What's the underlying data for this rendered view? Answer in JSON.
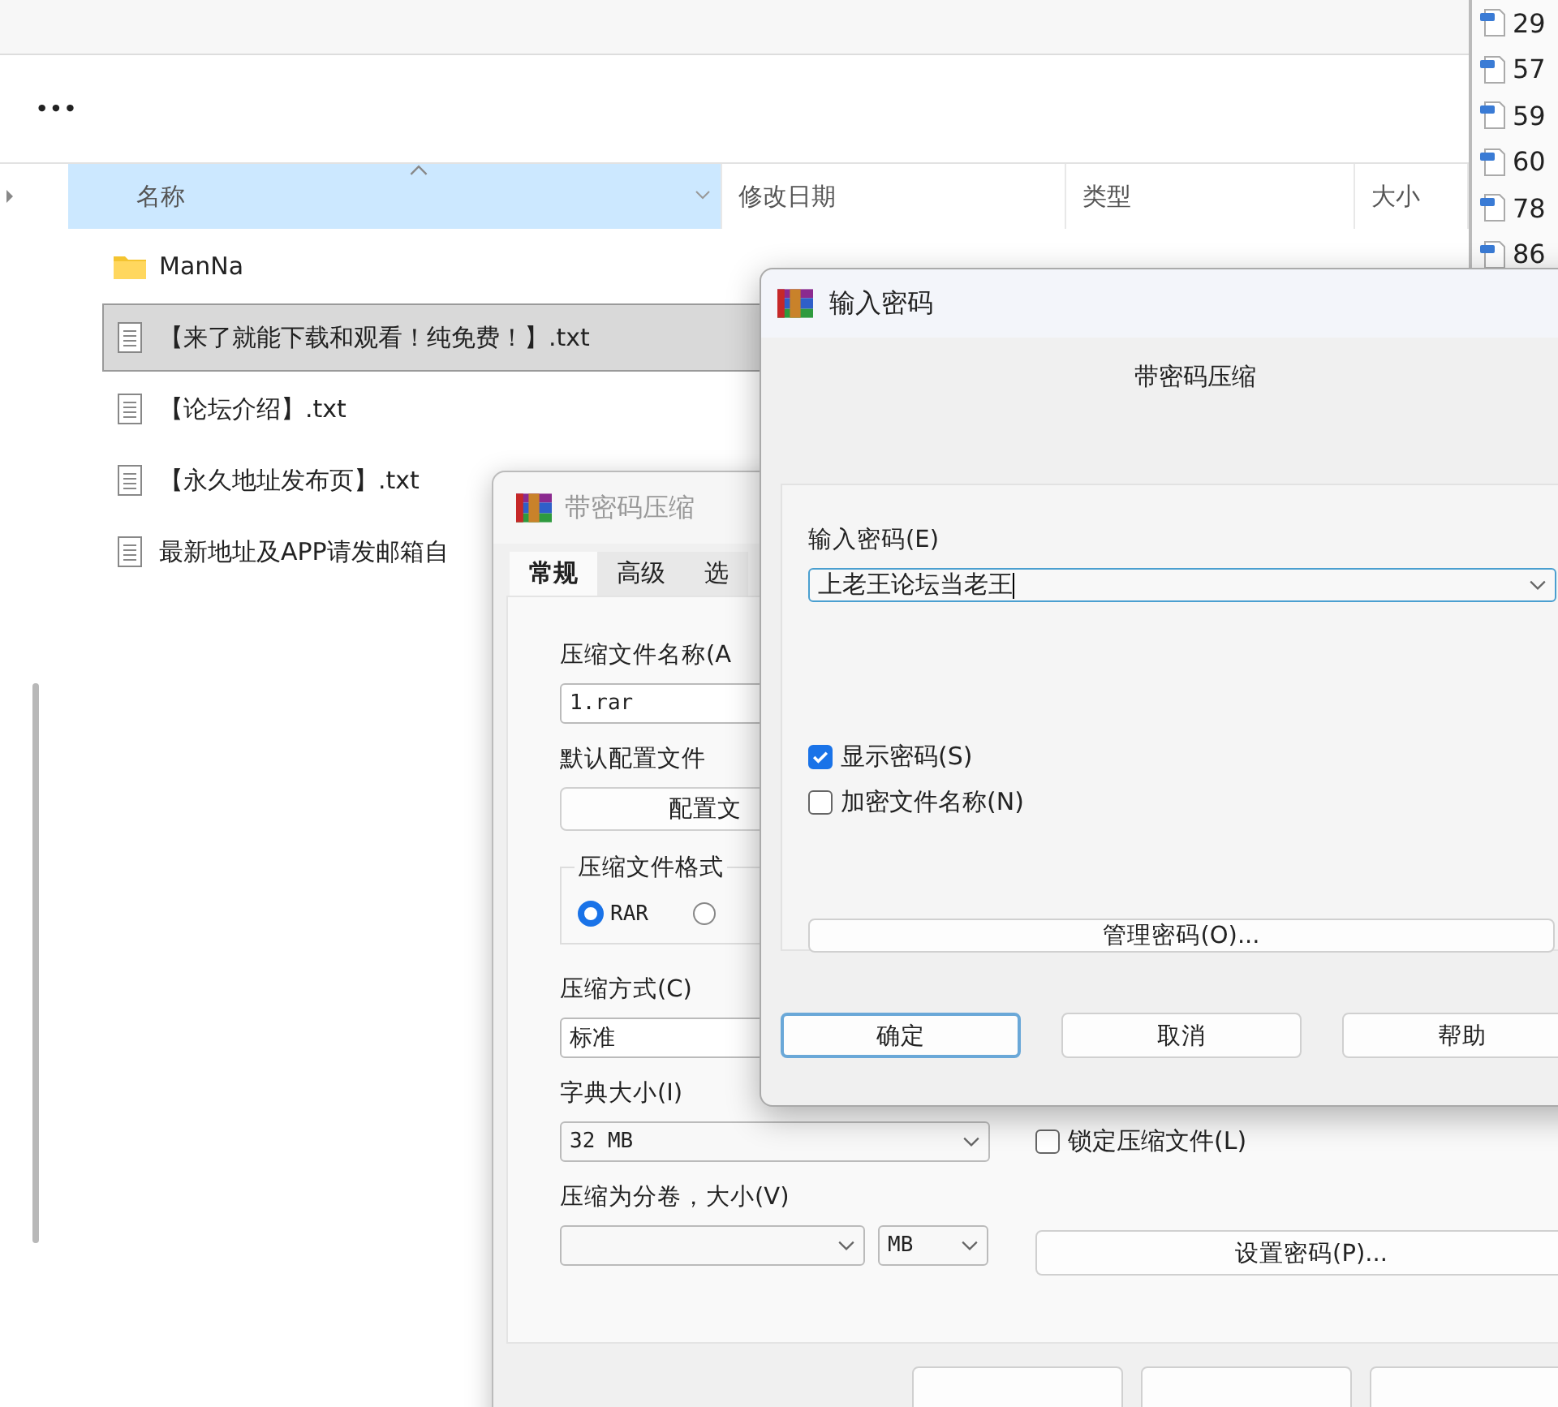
{
  "explorer": {
    "more_button": "•••",
    "columns": [
      {
        "label": "名称",
        "selected": true
      },
      {
        "label": "修改日期",
        "selected": false
      },
      {
        "label": "类型",
        "selected": false
      },
      {
        "label": "大小",
        "selected": false
      }
    ],
    "files": [
      {
        "kind": "folder",
        "name": "ManNa",
        "selected": false
      },
      {
        "kind": "text",
        "name": "【来了就能下载和观看！纯免费！】.txt",
        "selected": true
      },
      {
        "kind": "text",
        "name": "【论坛介绍】.txt",
        "selected": false
      },
      {
        "kind": "text",
        "name": "【永久地址发布页】.txt",
        "selected": false
      },
      {
        "kind": "text",
        "name": "最新地址及APP请发邮箱自",
        "selected": false
      }
    ],
    "side_files": [
      "29",
      "57",
      "59",
      "60",
      "78",
      "86"
    ]
  },
  "archive_dialog": {
    "title": "带密码压缩",
    "tabs": [
      {
        "label": "常规",
        "selected": true
      },
      {
        "label": "高级",
        "selected": false
      },
      {
        "label": "选",
        "selected": false
      }
    ],
    "archive_name_label": "压缩文件名称(A",
    "archive_name": "1.rar",
    "profile_label": "默认配置文件",
    "profile_button": "配置文",
    "format_group": "压缩文件格式",
    "formats": [
      {
        "label": "RAR",
        "selected": true
      },
      {
        "selected": false
      }
    ],
    "method_label": "压缩方式(C)",
    "method": "标准",
    "dictionary_label": "字典大小(I)",
    "dictionary": "32 MB",
    "volume_label": "压缩为分卷，大小(V)",
    "volume_unit": "MB",
    "options": [
      {
        "label": "锁定压缩文件(L)",
        "checked": false
      }
    ],
    "password_button": "设置密码(P)..."
  },
  "password_dialog": {
    "title": "输入密码",
    "heading": "带密码压缩",
    "password_label": "输入密码(E)",
    "password": "上老王论坛当老王",
    "options": [
      {
        "label": "显示密码(S)",
        "checked": true
      },
      {
        "label": "加密文件名称(N)",
        "checked": false
      }
    ],
    "manage_button": "管理密码(O)...",
    "buttons": [
      {
        "label": "确定",
        "default": true
      },
      {
        "label": "取消",
        "default": false
      },
      {
        "label": "帮助",
        "default": false
      }
    ]
  }
}
